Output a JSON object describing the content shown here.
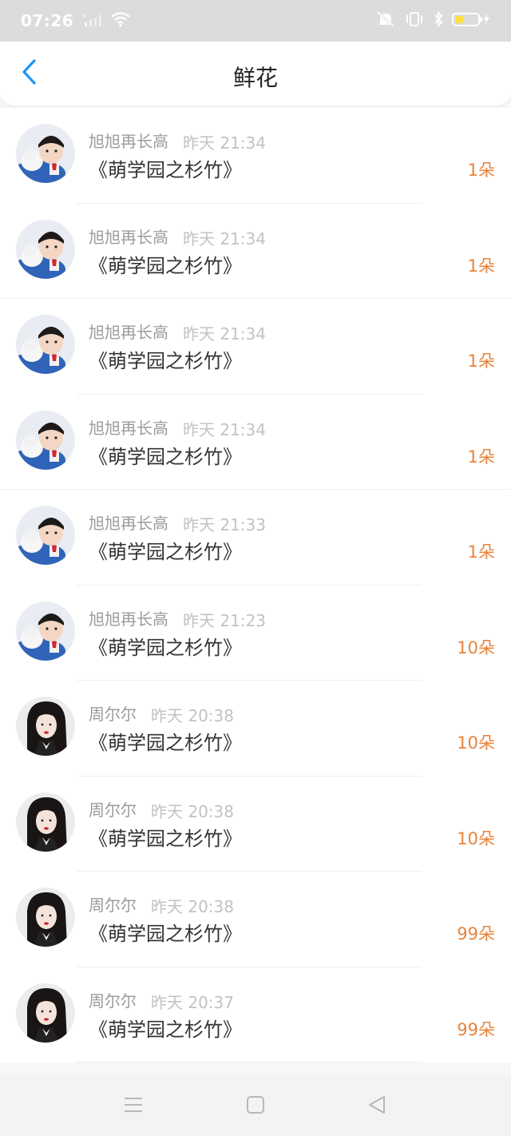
{
  "status_bar": {
    "time": "07:26"
  },
  "header": {
    "title": "鲜花"
  },
  "colors": {
    "accent": "#2196f3",
    "count": "#e8833a"
  },
  "items": [
    {
      "name": "旭旭再长高",
      "time": "昨天 21:34",
      "gift": "《萌学园之杉竹》",
      "count": "1朵",
      "avatar": "boy"
    },
    {
      "name": "旭旭再长高",
      "time": "昨天 21:34",
      "gift": "《萌学园之杉竹》",
      "count": "1朵",
      "avatar": "boy"
    },
    {
      "name": "旭旭再长高",
      "time": "昨天 21:34",
      "gift": "《萌学园之杉竹》",
      "count": "1朵",
      "avatar": "boy"
    },
    {
      "name": "旭旭再长高",
      "time": "昨天 21:34",
      "gift": "《萌学园之杉竹》",
      "count": "1朵",
      "avatar": "boy"
    },
    {
      "name": "旭旭再长高",
      "time": "昨天 21:33",
      "gift": "《萌学园之杉竹》",
      "count": "1朵",
      "avatar": "boy"
    },
    {
      "name": "旭旭再长高",
      "time": "昨天 21:23",
      "gift": "《萌学园之杉竹》",
      "count": "10朵",
      "avatar": "boy"
    },
    {
      "name": "周尔尔",
      "time": "昨天 20:38",
      "gift": "《萌学园之杉竹》",
      "count": "10朵",
      "avatar": "girl"
    },
    {
      "name": "周尔尔",
      "time": "昨天 20:38",
      "gift": "《萌学园之杉竹》",
      "count": "10朵",
      "avatar": "girl"
    },
    {
      "name": "周尔尔",
      "time": "昨天 20:38",
      "gift": "《萌学园之杉竹》",
      "count": "99朵",
      "avatar": "girl"
    },
    {
      "name": "周尔尔",
      "time": "昨天 20:37",
      "gift": "《萌学园之杉竹》",
      "count": "99朵",
      "avatar": "girl"
    }
  ]
}
